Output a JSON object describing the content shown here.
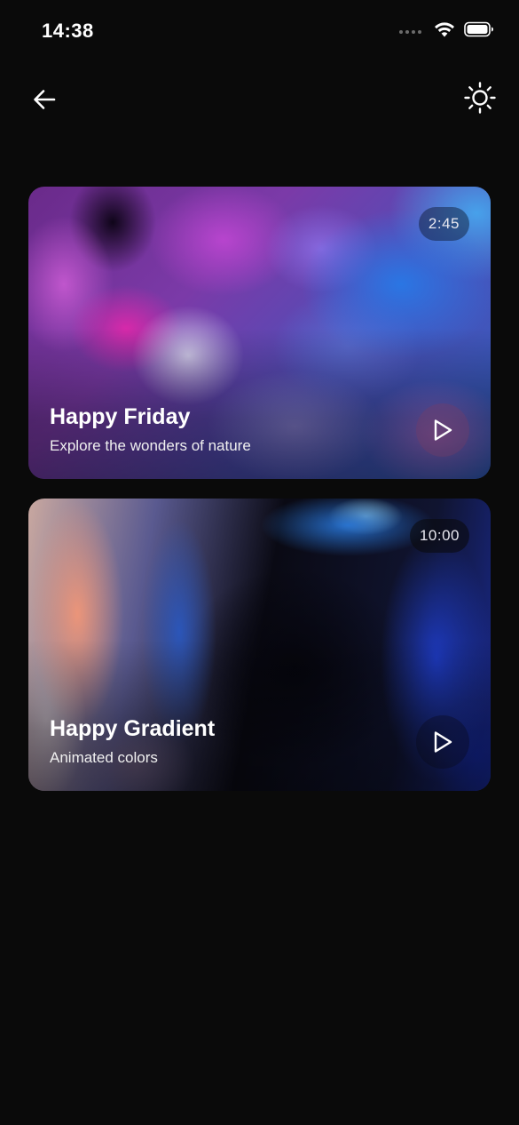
{
  "status_bar": {
    "time": "14:38",
    "icons": [
      "signal-dots-icon",
      "wifi-icon",
      "battery-icon"
    ]
  },
  "nav": {
    "back_icon": "arrow-left-icon",
    "theme_icon": "sun-icon"
  },
  "videos": [
    {
      "title": "Happy Friday",
      "subtitle": "Explore the wonders of nature",
      "duration": "2:45",
      "play_icon": "play-icon"
    },
    {
      "title": "Happy Gradient",
      "subtitle": "Animated colors",
      "duration": "10:00",
      "play_icon": "play-icon"
    }
  ],
  "colors": {
    "background": "#0a0a0a",
    "text": "#ffffff"
  }
}
